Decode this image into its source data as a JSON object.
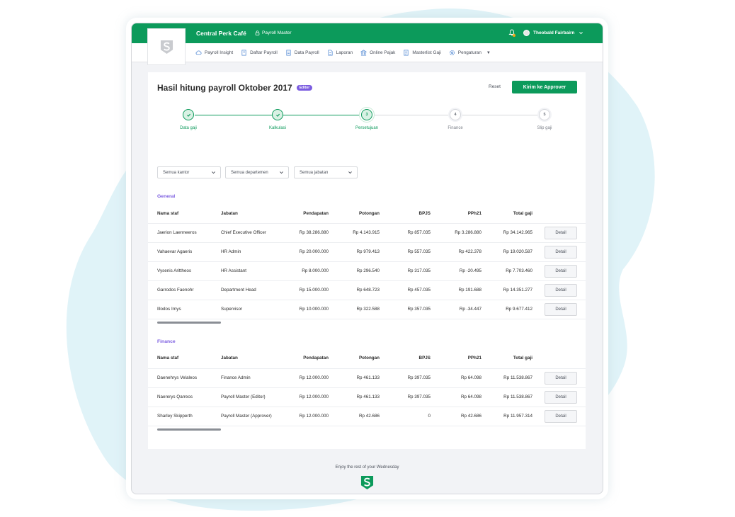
{
  "topbar": {
    "company": "Central Perk Café",
    "role": "Payroll Master",
    "user_name": "Theobald Fairbairn"
  },
  "nav": {
    "items": [
      {
        "label": "Payroll Insight",
        "icon": "cloud-icon"
      },
      {
        "label": "Daftar Payroll",
        "icon": "building-icon"
      },
      {
        "label": "Data Payroll",
        "icon": "document-icon"
      },
      {
        "label": "Laporan",
        "icon": "report-icon"
      },
      {
        "label": "Online Pajak",
        "icon": "bank-icon"
      },
      {
        "label": "Masterlist Gaji",
        "icon": "list-icon"
      },
      {
        "label": "Pengaturan",
        "icon": "gear-icon"
      }
    ]
  },
  "page": {
    "title": "Hasil hitung payroll Oktober 2017",
    "badge": "Editor",
    "reset_label": "Reset",
    "submit_label": "Kirim ke Approver"
  },
  "steps": [
    {
      "number": "1",
      "label": "Data gaji",
      "status": "done"
    },
    {
      "number": "2",
      "label": "Kalkulasi",
      "status": "done"
    },
    {
      "number": "3",
      "label": "Persetujuan",
      "status": "active"
    },
    {
      "number": "4",
      "label": "Finance",
      "status": "pending"
    },
    {
      "number": "5",
      "label": "Slip gaji",
      "status": "pending"
    }
  ],
  "filters": {
    "office": "Semua kantor",
    "department": "Semua departemen",
    "position": "Semua jabatan"
  },
  "table_headers": {
    "name": "Nama staf",
    "position": "Jabatan",
    "income": "Pendapatan",
    "deduction": "Potongan",
    "bpjs": "BPJS",
    "pph21": "PPh21",
    "total": "Total gaji"
  },
  "detail_label": "Detail",
  "sections": [
    {
      "title": "General",
      "rows": [
        {
          "name": "Jaerion Laenneeros",
          "position": "Chief Executive Officer",
          "income": "Rp 38.286.880",
          "deduction": "Rp 4.143.915",
          "bpjs": "Rp 857.035",
          "pph21": "Rp 3.286.880",
          "total": "Rp 34.142.965"
        },
        {
          "name": "Vahaevar Agaeris",
          "position": "HR Admin",
          "income": "Rp 20.000.000",
          "deduction": "Rp 979.413",
          "bpjs": "Rp 557.035",
          "pph21": "Rp 422.378",
          "total": "Rp 19.020.587"
        },
        {
          "name": "Vysenis Arittheos",
          "position": "HR Assistant",
          "income": "Rp 8.000.000",
          "deduction": "Rp 296.540",
          "bpjs": "Rp 317.035",
          "pph21": "Rp -20.495",
          "total": "Rp 7.703.460"
        },
        {
          "name": "Garrodos Faenohr",
          "position": "Department Head",
          "income": "Rp 15.000.000",
          "deduction": "Rp 648.723",
          "bpjs": "Rp 457.035",
          "pph21": "Rp 191.688",
          "total": "Rp 14.351.277"
        },
        {
          "name": "Illodos Irnys",
          "position": "Supervisor",
          "income": "Rp 10.000.000",
          "deduction": "Rp 322.588",
          "bpjs": "Rp 357.035",
          "pph21": "Rp -34.447",
          "total": "Rp 9.677.412"
        }
      ]
    },
    {
      "title": "Finance",
      "rows": [
        {
          "name": "Daenehrys Velaleos",
          "position": "Finance Admin",
          "income": "Rp 12.000.000",
          "deduction": "Rp 461.133",
          "bpjs": "Rp 397.035",
          "pph21": "Rp 64.098",
          "total": "Rp 11.538.867"
        },
        {
          "name": "Naererys Qarreos",
          "position": "Payroll Master (Editor)",
          "income": "Rp 12.000.000",
          "deduction": "Rp 461.133",
          "bpjs": "Rp 397.035",
          "pph21": "Rp 64.098",
          "total": "Rp 11.538.867"
        },
        {
          "name": "Sharley Skipperth",
          "position": "Payroll Master (Approver)",
          "income": "Rp 12.000.000",
          "deduction": "Rp 42.686",
          "bpjs": "0",
          "pph21": "Rp 42.686",
          "total": "Rp 11.957.314"
        }
      ]
    }
  ],
  "footer": {
    "greeting": "Enjoy the rest of your Wednesday"
  },
  "colors": {
    "brand_green": "#0c9a5b",
    "accent_purple": "#7b5ce0",
    "background_blob": "#dff3f8"
  }
}
